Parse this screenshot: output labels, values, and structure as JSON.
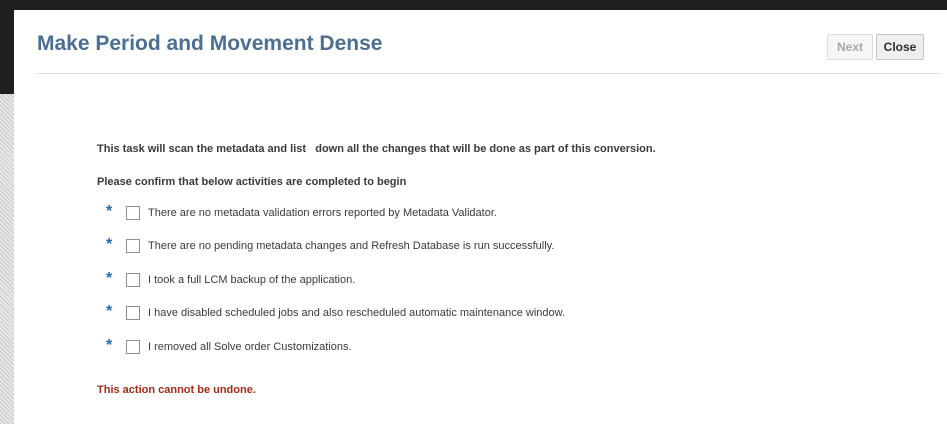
{
  "dialog": {
    "title": "Make Period and Movement Dense",
    "next_label": "Next",
    "close_label": "Close",
    "intro_text": "This task will scan the metadata and list   down all the changes that will be done as part of this conversion.",
    "confirm_text": "Please confirm that below activities are completed to begin",
    "required_marker": "*",
    "requirements": [
      {
        "label": "There are no metadata validation errors reported by Metadata Validator.",
        "checked": false
      },
      {
        "label": "There are no pending metadata changes and Refresh Database is run successfully.",
        "checked": false
      },
      {
        "label": "I took a full LCM backup of the application.",
        "checked": false
      },
      {
        "label": "I have disabled scheduled jobs and also rescheduled automatic maintenance window.",
        "checked": false
      },
      {
        "label": "I removed all Solve order Customizations.",
        "checked": false
      }
    ],
    "warning_text": "This action cannot be undone."
  },
  "colors": {
    "title": "#4a6f93",
    "required_marker": "#1b6db6",
    "warning": "#a32a16",
    "disabled_button_text": "#a9a9a9"
  }
}
